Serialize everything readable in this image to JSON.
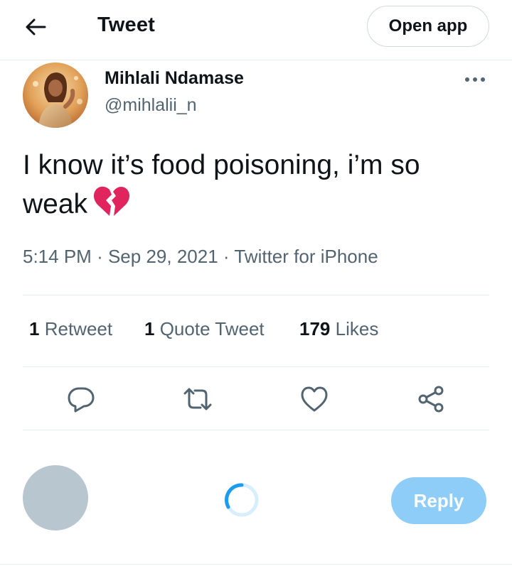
{
  "header": {
    "title": "Tweet",
    "open_app_label": "Open app"
  },
  "tweet": {
    "author_name": "Mihlali Ndamase",
    "author_handle": "@mihlalii_n",
    "text": "I know it’s food poisoning, i’m so weak",
    "emoji": "broken-heart",
    "time": "5:14 PM",
    "date": "Sep 29, 2021",
    "source": "Twitter for iPhone",
    "separator": "·"
  },
  "stats": {
    "retweets_count": "1",
    "retweets_label": "Retweet",
    "quotes_count": "1",
    "quotes_label": "Quote Tweet",
    "likes_count": "179",
    "likes_label": "Likes"
  },
  "composer": {
    "reply_label": "Reply"
  },
  "icons": [
    "back-arrow-icon",
    "more-icon",
    "reply-icon",
    "retweet-icon",
    "like-icon",
    "share-icon",
    "broken-heart-icon",
    "loading-spinner-icon"
  ],
  "colors": {
    "text": "#0f1419",
    "secondary": "#536471",
    "divider": "#e6ecf0",
    "reply_button": "#8ecdf8",
    "emoji": "#e0245e"
  }
}
